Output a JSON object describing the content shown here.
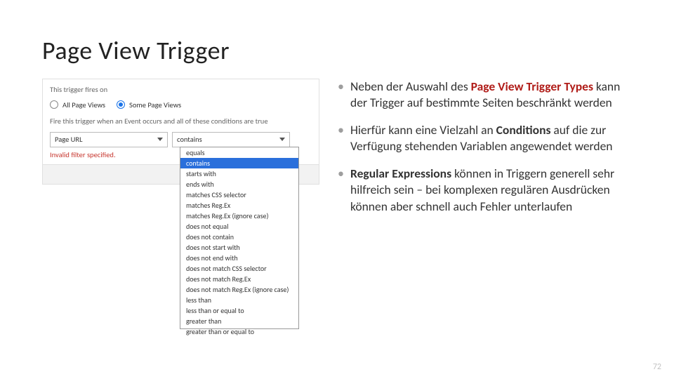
{
  "title": "Page View Trigger",
  "ui": {
    "fires_on_label": "This trigger fires on",
    "radio_all": "All Page Views",
    "radio_some": "Some Page Views",
    "cond_label": "Fire this trigger when an Event occurs and all of these conditions are true",
    "var_select": "Page URL",
    "op_select": "contains",
    "error": "Invalid filter specified.",
    "options": [
      "equals",
      "contains",
      "starts with",
      "ends with",
      "matches CSS selector",
      "matches Reg.Ex",
      "matches Reg.Ex (ignore case)",
      "does not equal",
      "does not contain",
      "does not start with",
      "does not end with",
      "does not match CSS selector",
      "does not match Reg.Ex",
      "does not match Reg.Ex (ignore case)",
      "less than",
      "less than or equal to",
      "greater than",
      "greater than or equal to"
    ],
    "selected_index": 1
  },
  "bullets": {
    "b1_pre": "Neben der Auswahl des ",
    "b1_strong": "Page View Trigger Types",
    "b1_post": " kann der Trigger auf bestimmte Seiten beschränkt werden",
    "b2_pre": "Hierfür kann eine Vielzahl an ",
    "b2_strong": "Conditions",
    "b2_post": " auf die zur Verfügung stehenden Variablen angewendet werden",
    "b3_strong": "Regular Expressions",
    "b3_post": " können in Triggern generell sehr hilfreich sein – bei komplexen regulären Ausdrücken können aber schnell auch Fehler unterlaufen"
  },
  "page_number": "72"
}
